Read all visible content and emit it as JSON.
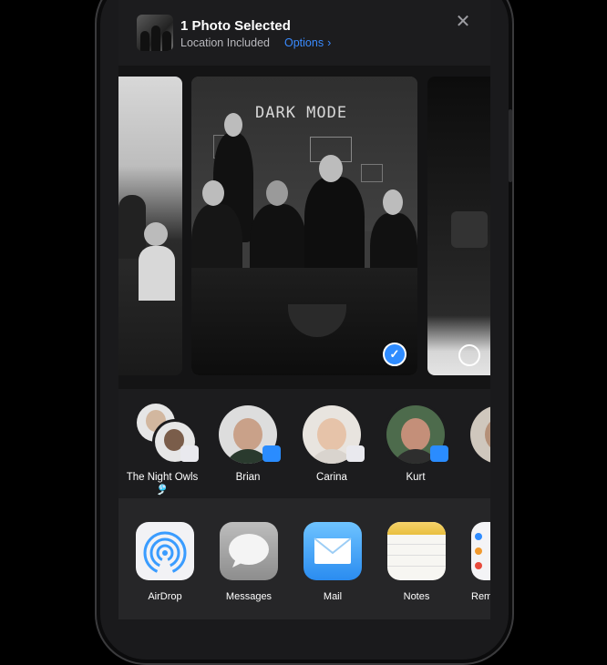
{
  "header": {
    "title": "1 Photo Selected",
    "subtitle": "Location Included",
    "options_label": "Options",
    "close_glyph": "✕"
  },
  "photo": {
    "chalk_text": "DARK MODE",
    "selected": true
  },
  "contacts": [
    {
      "name": "The Night Owls 🎐",
      "badge": "messages"
    },
    {
      "name": "Brian",
      "badge": "airdrop"
    },
    {
      "name": "Carina",
      "badge": "messages"
    },
    {
      "name": "Kurt",
      "badge": "airdrop"
    }
  ],
  "apps": [
    {
      "label": "AirDrop",
      "icon": "airdrop-icon"
    },
    {
      "label": "Messages",
      "icon": "messages-icon"
    },
    {
      "label": "Mail",
      "icon": "mail-icon"
    },
    {
      "label": "Notes",
      "icon": "notes-icon"
    },
    {
      "label": "Rem",
      "icon": "reminders-icon"
    }
  ],
  "colors": {
    "accent": "#2f8cff",
    "sheet_bg": "#1c1c1e"
  }
}
